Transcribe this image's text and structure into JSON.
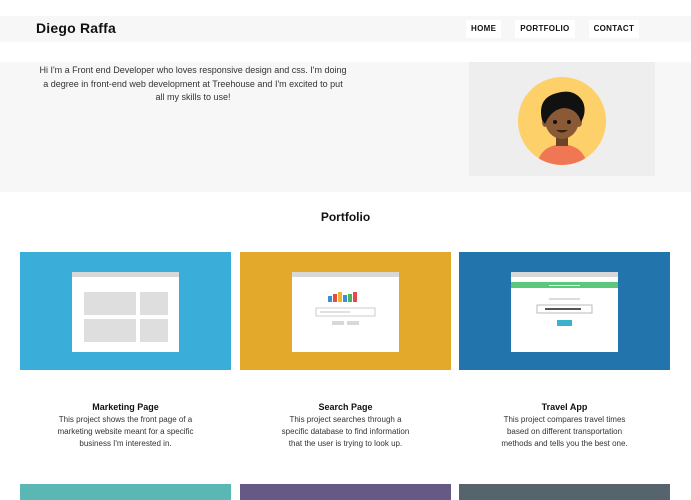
{
  "header": {
    "brand": "Diego Raffa",
    "nav": [
      "HOME",
      "PORTFOLIO",
      "CONTACT"
    ]
  },
  "hero": {
    "intro": "Hi I'm a Front end Developer who loves responsive design and css. I'm doing a degree in front-end web development at Treehouse and I'm excited to put all my skills to use!",
    "avatar_icon": "person-avatar-icon"
  },
  "portfolio": {
    "title": "Portfolio",
    "projects": [
      {
        "title": "Marketing Page",
        "description": "This project shows the front page of a marketing website meant for a specific business I'm interested in.",
        "color": "#3aaed8",
        "icon": "marketing-page-screenshot-icon"
      },
      {
        "title": "Search Page",
        "description": "This project searches through a specific database to find information that the user is trying to look up.",
        "color": "#e2a92a",
        "icon": "search-page-screenshot-icon"
      },
      {
        "title": "Travel App",
        "description": "This project compares travel times based on different transportation methods and tells you the best one.",
        "color": "#2274ad",
        "icon": "travel-app-screenshot-icon"
      }
    ],
    "partial_cards": [
      {
        "color": "#5ab8b4"
      },
      {
        "color": "#655985"
      },
      {
        "color": "#56646e"
      }
    ]
  }
}
